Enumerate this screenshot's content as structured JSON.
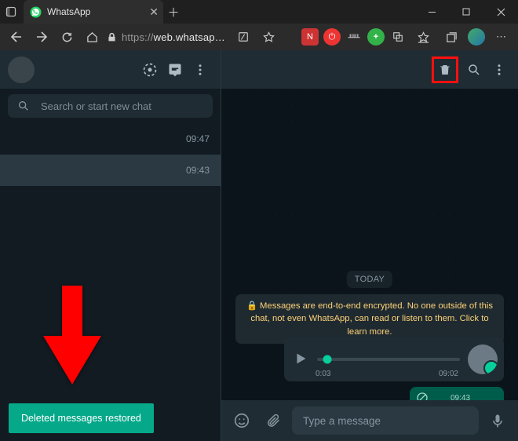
{
  "window": {
    "tab_title": "WhatsApp",
    "url_scheme": "https://",
    "url_host": "web.whatsap…"
  },
  "sidebar": {
    "search_placeholder": "Search or start new chat",
    "chats": [
      {
        "time": "09:47"
      },
      {
        "time": "09:43"
      }
    ]
  },
  "conversation": {
    "day_label": "TODAY",
    "encryption_notice": "Messages are end-to-end encrypted. No one outside of this chat, not even WhatsApp, can read or listen to them. Click to learn more.",
    "audio": {
      "elapsed": "0:03",
      "time": "09:02"
    },
    "sent": {
      "time": "09:43"
    }
  },
  "composer": {
    "placeholder": "Type a message"
  },
  "toast": {
    "text": "Deleted messages restored"
  }
}
